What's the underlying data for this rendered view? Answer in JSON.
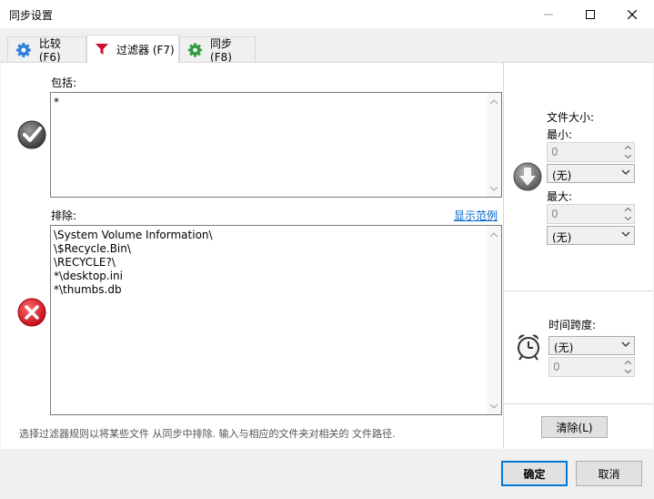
{
  "window": {
    "title": "同步设置"
  },
  "tabs": [
    {
      "label": "比较 (F6)",
      "icon": "gear-icon-blue"
    },
    {
      "label": "过滤器 (F7)",
      "icon": "funnel-icon"
    },
    {
      "label": "同步 (F8)",
      "icon": "gear-icon-green"
    }
  ],
  "include": {
    "label": "包括:",
    "value": "*"
  },
  "exclude": {
    "label": "排除:",
    "value": "\\System Volume Information\\\n\\$Recycle.Bin\\\n\\RECYCLE?\\\n*\\desktop.ini\n*\\thumbs.db",
    "show_examples_link": "显示范例"
  },
  "file_size": {
    "label": "文件大小:",
    "min_label": "最小:",
    "min_value": "0",
    "min_unit": "(无)",
    "max_label": "最大:",
    "max_value": "0",
    "max_unit": "(无)"
  },
  "time_span": {
    "label": "时间跨度:",
    "unit": "(无)",
    "value": "0"
  },
  "clear_button": "清除(L)",
  "hint": "选择过滤器规则以将某些文件 从同步中排除. 输入与相应的文件夹对相关的 文件路径.",
  "ok_button": "确定",
  "cancel_button": "取消"
}
